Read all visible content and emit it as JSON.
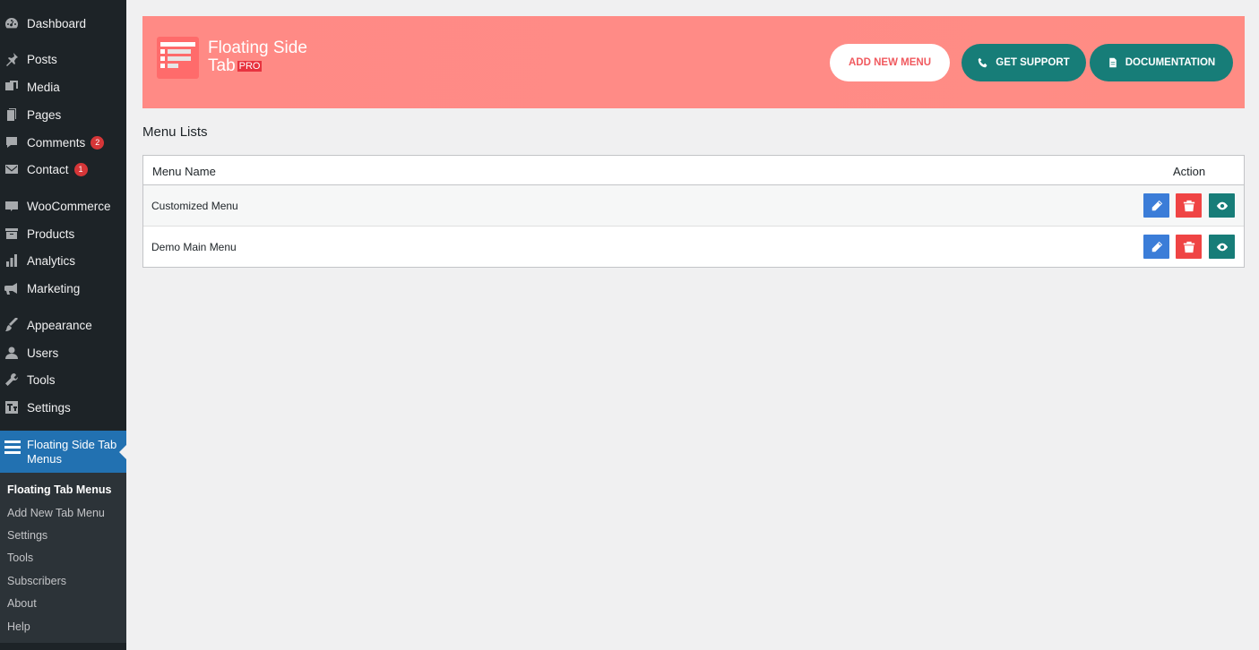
{
  "sidebar": {
    "items": [
      {
        "label": "Dashboard",
        "icon": "dashboard-icon"
      },
      {
        "label": "Posts",
        "icon": "pin-icon"
      },
      {
        "label": "Media",
        "icon": "media-icon"
      },
      {
        "label": "Pages",
        "icon": "pages-icon"
      },
      {
        "label": "Comments",
        "icon": "comment-icon",
        "badge": "2"
      },
      {
        "label": "Contact",
        "icon": "mail-icon",
        "badge": "1"
      },
      {
        "label": "WooCommerce",
        "icon": "woo-icon"
      },
      {
        "label": "Products",
        "icon": "archive-icon"
      },
      {
        "label": "Analytics",
        "icon": "bar-chart-icon"
      },
      {
        "label": "Marketing",
        "icon": "megaphone-icon"
      },
      {
        "label": "Appearance",
        "icon": "brush-icon"
      },
      {
        "label": "Users",
        "icon": "user-icon"
      },
      {
        "label": "Tools",
        "icon": "wrench-icon"
      },
      {
        "label": "Settings",
        "icon": "settings-icon"
      }
    ],
    "active": {
      "label": "Floating Side Tab Menus",
      "icon": "menu-icon"
    },
    "submenu": [
      {
        "label": "Floating Tab Menus",
        "current": true
      },
      {
        "label": "Add New Tab Menu"
      },
      {
        "label": "Settings"
      },
      {
        "label": "Tools"
      },
      {
        "label": "Subscribers"
      },
      {
        "label": "About"
      },
      {
        "label": "Help"
      }
    ]
  },
  "banner": {
    "logo_line1": "Floating Side",
    "logo_line2": "Tab",
    "logo_tag": "PRO",
    "add_new_label": "ADD NEW MENU",
    "support_label": "GET SUPPORT",
    "docs_label": "DOCUMENTATION"
  },
  "main": {
    "section_title": "Menu Lists",
    "columns": {
      "name": "Menu Name",
      "action": "Action"
    },
    "rows": [
      {
        "name": "Customized Menu"
      },
      {
        "name": "Demo Main Menu"
      }
    ]
  },
  "colors": {
    "sidebar_bg": "#1d2327",
    "active_bg": "#2271b1",
    "banner_bg": "#ff8a85",
    "teal": "#177d78",
    "edit_blue": "#3b7dd8",
    "delete_red": "#ef4444"
  }
}
